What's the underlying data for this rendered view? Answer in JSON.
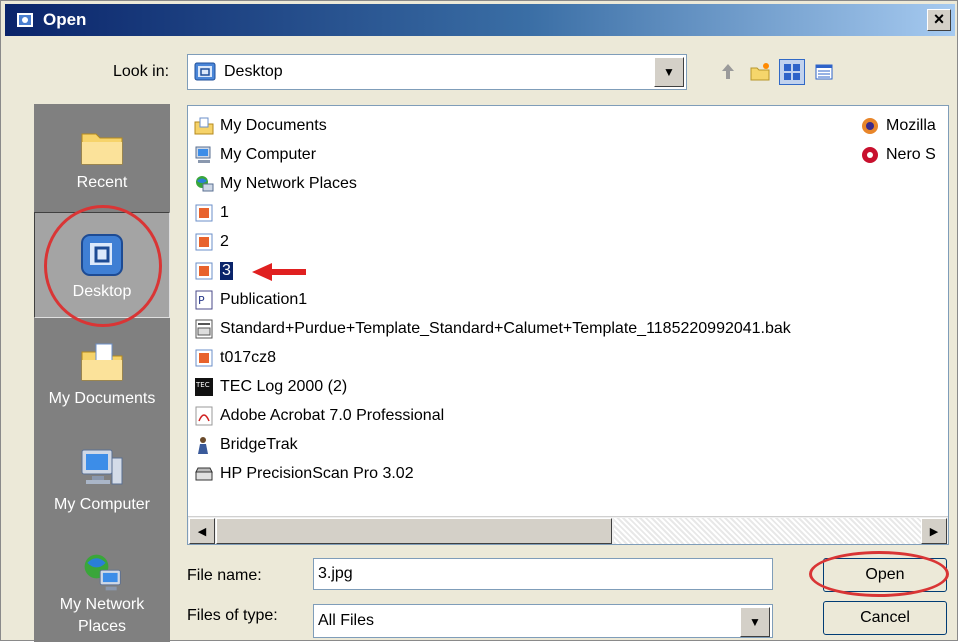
{
  "window": {
    "title": "Open",
    "close_label": "×"
  },
  "lookin": {
    "label": "Look in:",
    "value": "Desktop"
  },
  "toolbar": {
    "icons": [
      "up-one-level-icon",
      "create-new-folder-icon",
      "view-menu-icon",
      "details-view-icon"
    ]
  },
  "places": [
    {
      "label": "Recent",
      "icon": "recent-folder-icon"
    },
    {
      "label": "Desktop",
      "icon": "desktop-icon",
      "selected": true
    },
    {
      "label": "My Documents",
      "icon": "my-documents-icon"
    },
    {
      "label": "My Computer",
      "icon": "my-computer-icon"
    },
    {
      "label": "My Network Places",
      "icon": "my-network-places-icon"
    }
  ],
  "files": [
    {
      "name": "My Documents",
      "icon": "my-documents-icon"
    },
    {
      "name": "My Computer",
      "icon": "my-computer-icon"
    },
    {
      "name": "My Network Places",
      "icon": "network-places-icon"
    },
    {
      "name": "1",
      "icon": "image-file-icon"
    },
    {
      "name": "2",
      "icon": "image-file-icon"
    },
    {
      "name": "3",
      "icon": "image-file-icon",
      "selected": true
    },
    {
      "name": "Publication1",
      "icon": "publisher-file-icon"
    },
    {
      "name": "Standard+Purdue+Template_Standard+Calumet+Template_1185220992041.bak",
      "icon": "bak-file-icon"
    },
    {
      "name": "t017cz8",
      "icon": "image-file-icon"
    },
    {
      "name": "TEC Log 2000 (2)",
      "icon": "tec-shortcut-icon"
    },
    {
      "name": "Adobe Acrobat 7.0 Professional",
      "icon": "acrobat-shortcut-icon"
    },
    {
      "name": "BridgeTrak",
      "icon": "bridgetrak-shortcut-icon"
    },
    {
      "name": "HP PrecisionScan Pro 3.02",
      "icon": "scanner-shortcut-icon"
    }
  ],
  "files_col2": [
    {
      "name": "Mozilla",
      "icon": "mozilla-shortcut-icon"
    },
    {
      "name": "Nero S",
      "icon": "nero-shortcut-icon"
    }
  ],
  "filename": {
    "label": "File name:",
    "value": "3.jpg"
  },
  "filetype": {
    "label": "Files of type:",
    "value": "All Files"
  },
  "buttons": {
    "open": "Open",
    "cancel": "Cancel"
  },
  "colors": {
    "annotation": "#d93535",
    "selection": "#0a246a",
    "places_bg": "#808080"
  }
}
